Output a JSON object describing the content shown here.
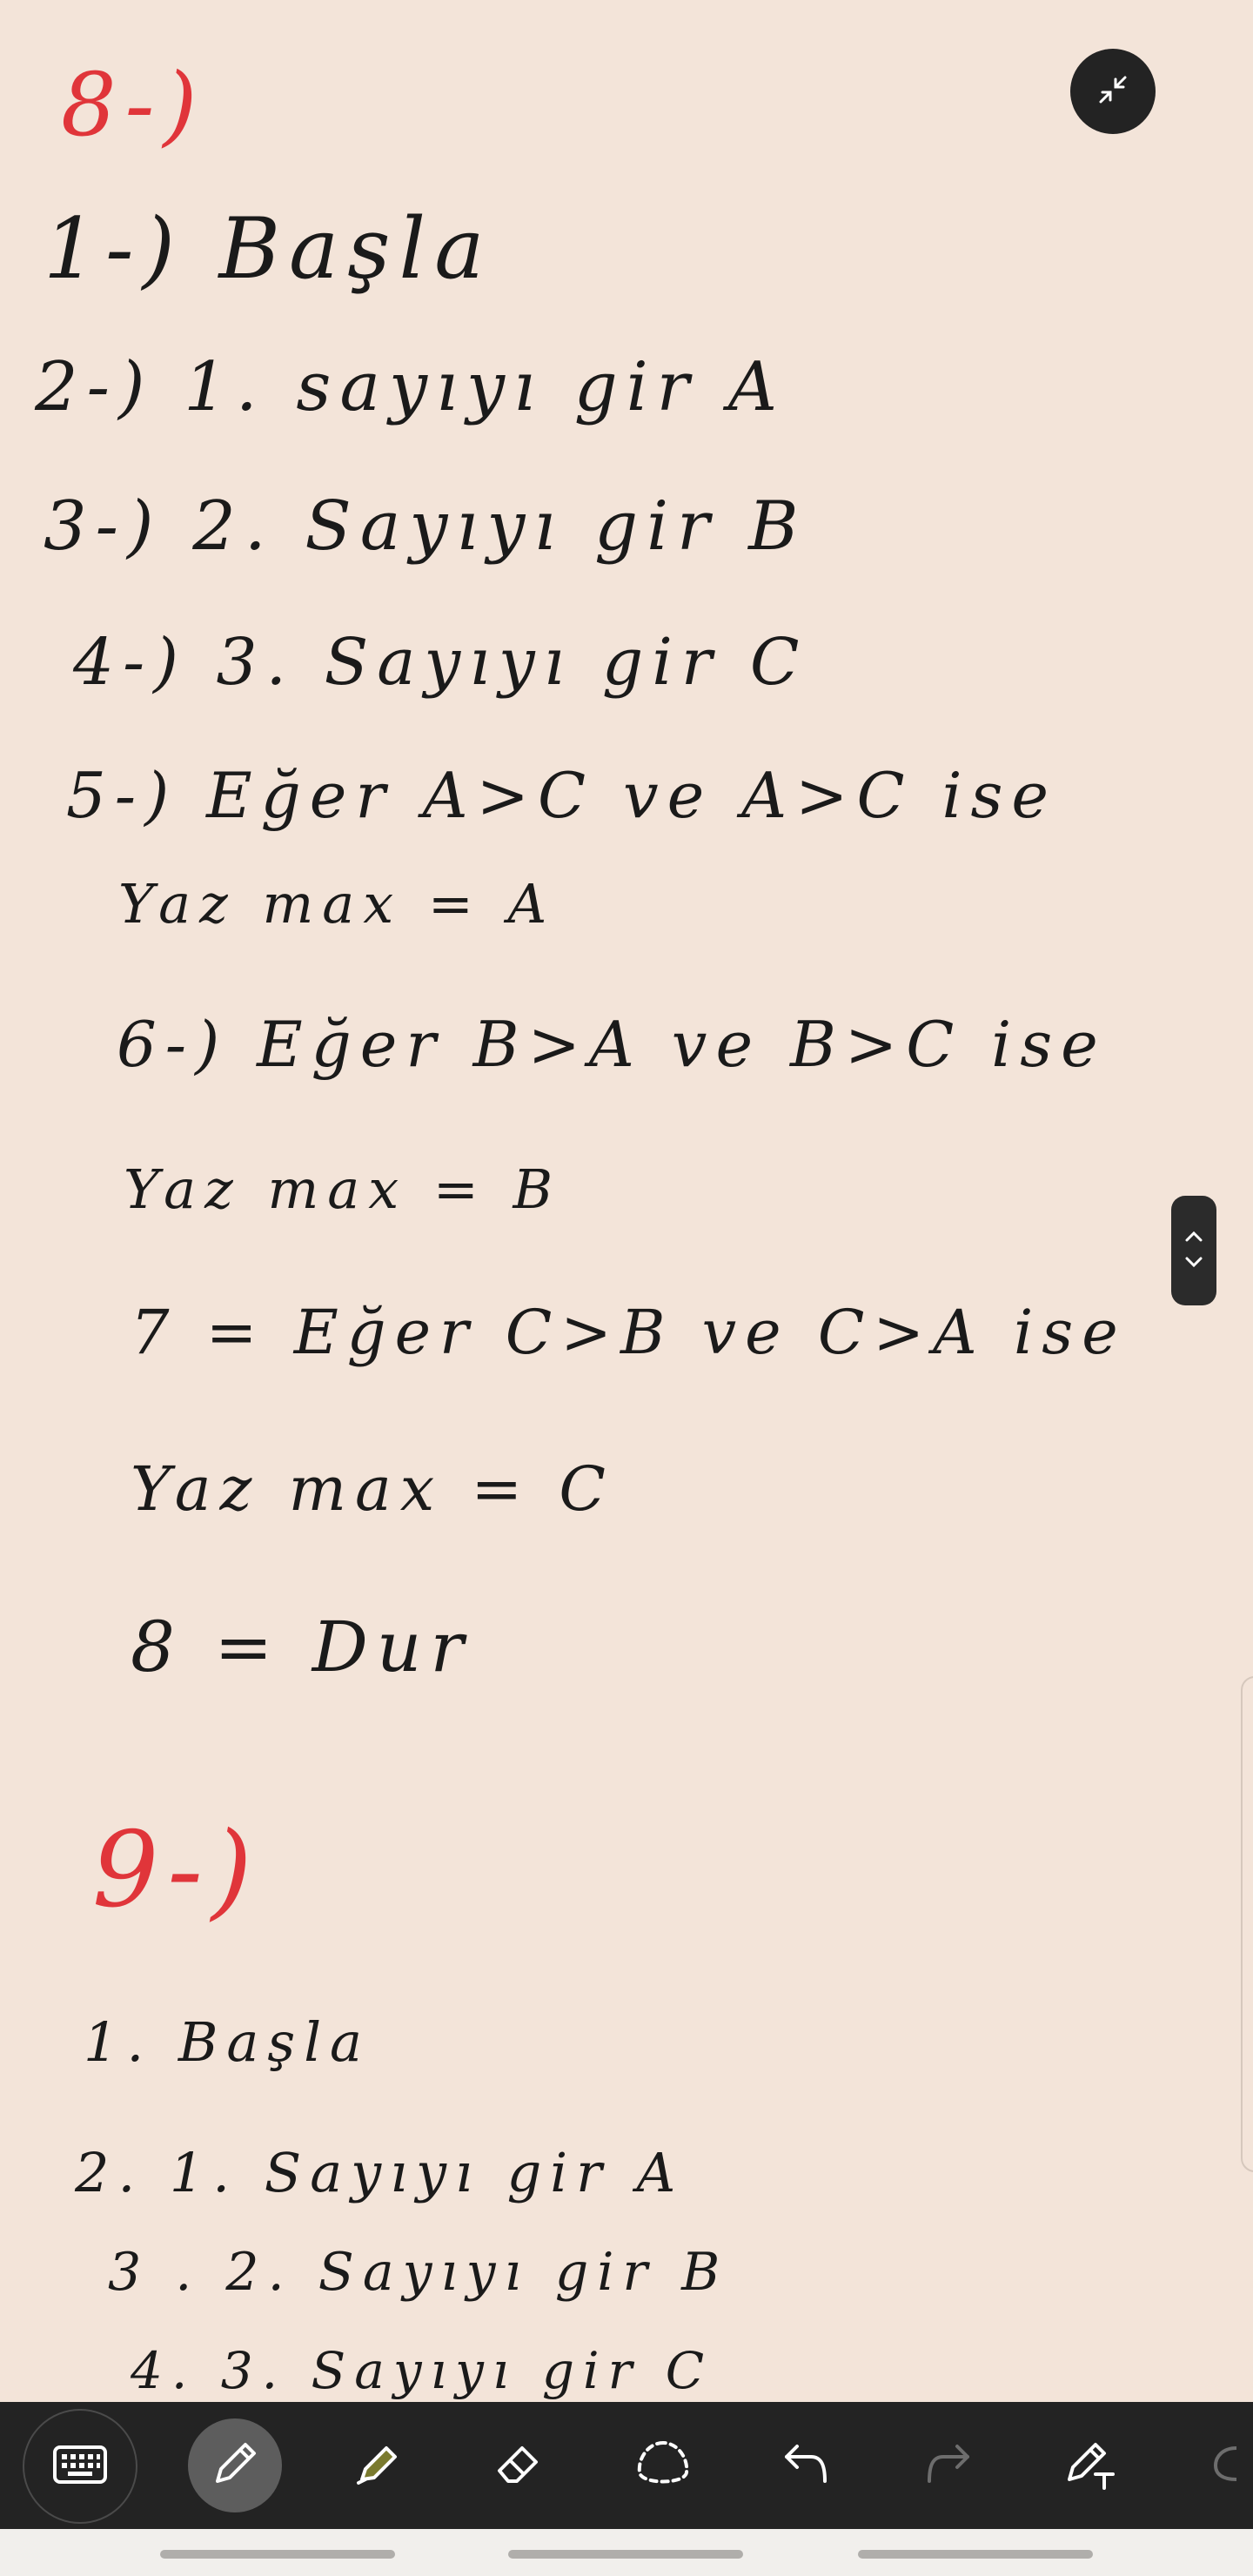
{
  "note": {
    "lines": [
      {
        "text": "8-)",
        "color": "red"
      },
      {
        "text": "1-) Başla",
        "color": "black"
      },
      {
        "text": "2-) 1. sayıyı gir A",
        "color": "black"
      },
      {
        "text": "3-) 2. Sayıyı gir B",
        "color": "black"
      },
      {
        "text": "4-) 3. Sayıyı gir C",
        "color": "black"
      },
      {
        "text": "5-) Eğer A>C ve A>C ise",
        "color": "black"
      },
      {
        "text": "Yaz max = A",
        "color": "black"
      },
      {
        "text": "6-) Eğer B>A ve B>C ise",
        "color": "black"
      },
      {
        "text": "Yaz max = B",
        "color": "black"
      },
      {
        "text": "7 = Eğer C>B ve C>A ise",
        "color": "black"
      },
      {
        "text": "Yaz   max = C",
        "color": "black"
      },
      {
        "text": "8 = Dur",
        "color": "black"
      },
      {
        "text": "9-)",
        "color": "red"
      },
      {
        "text": "1. Başla",
        "color": "black"
      },
      {
        "text": "2.   1. Sayıyı gir A",
        "color": "black"
      },
      {
        "text": "3 . 2. Sayıyı gir B",
        "color": "black"
      },
      {
        "text": "4. 3. Sayıyı gir C",
        "color": "black"
      }
    ]
  },
  "controls": {
    "collapse_icon": "collapse-arrows-icon",
    "scroll_icons": [
      "chevron-up-icon",
      "chevron-down-icon"
    ]
  },
  "toolbar": {
    "tools": [
      {
        "icon": "keyboard-icon",
        "active": false
      },
      {
        "icon": "pen-icon",
        "active": true
      },
      {
        "icon": "highlighter-icon",
        "active": false
      },
      {
        "icon": "eraser-icon",
        "active": false
      },
      {
        "icon": "lasso-select-icon",
        "active": false
      },
      {
        "icon": "undo-icon",
        "active": false
      },
      {
        "icon": "redo-icon",
        "active": false
      },
      {
        "icon": "pen-to-text-icon",
        "active": false
      }
    ]
  },
  "colors": {
    "paper": "#f3e4d9",
    "ink_black": "#1a1a1a",
    "ink_red": "#e0353a",
    "toolbar": "#232323",
    "highlighter": "#7a7a2e"
  }
}
